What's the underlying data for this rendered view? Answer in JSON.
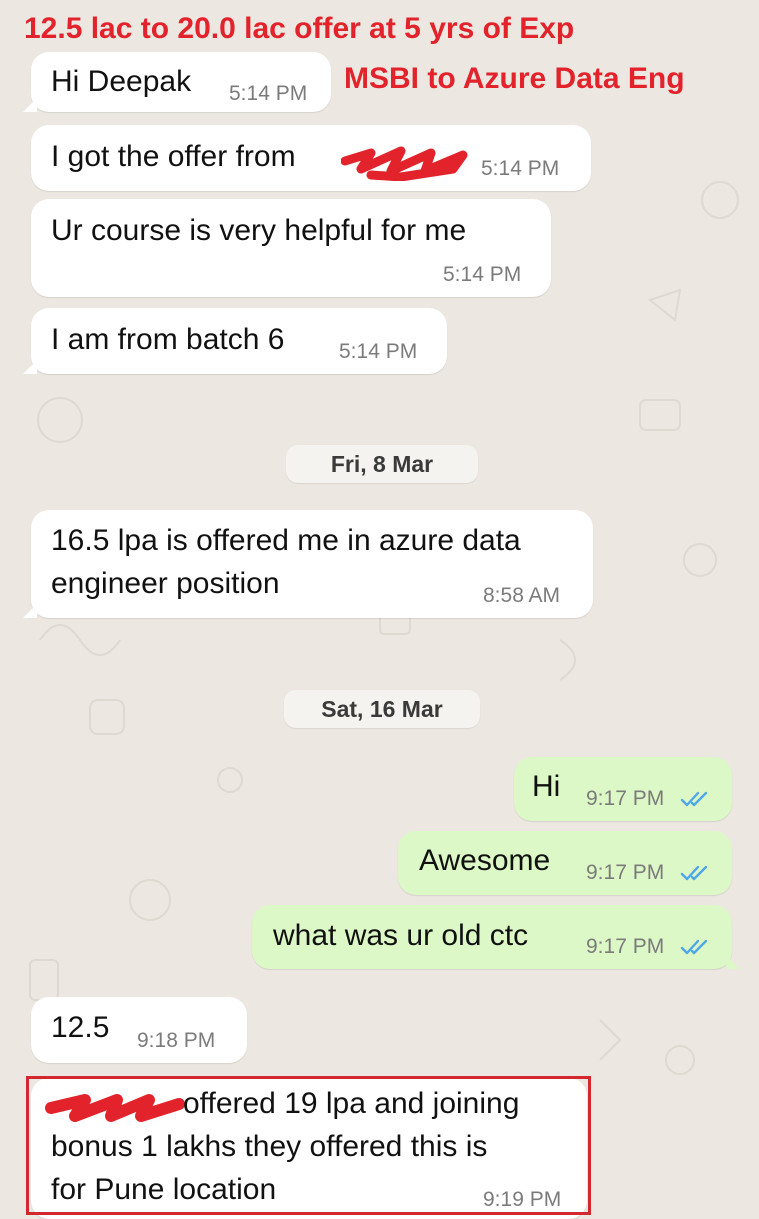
{
  "annotations": {
    "title": "12.5 lac to 20.0 lac offer at 5 yrs of Exp",
    "subtitle": "MSBI to Azure Data Eng"
  },
  "messages": [
    {
      "id": "m1",
      "direction": "in",
      "text": "Hi Deepak",
      "time": "5:14 PM"
    },
    {
      "id": "m2",
      "direction": "in",
      "text": "I got the offer from",
      "time": "5:14 PM"
    },
    {
      "id": "m3",
      "direction": "in",
      "text": "Ur course is very helpful for me",
      "time": "5:14 PM"
    },
    {
      "id": "m4",
      "direction": "in",
      "text": "I am from batch 6",
      "time": "5:14 PM"
    },
    {
      "id": "m5",
      "direction": "in",
      "lines": [
        "16.5 lpa is offered me in azure data",
        "engineer position"
      ],
      "time": "8:58 AM"
    },
    {
      "id": "m6",
      "direction": "out",
      "text": "Hi",
      "time": "9:17 PM",
      "status": "read"
    },
    {
      "id": "m7",
      "direction": "out",
      "text": "Awesome",
      "time": "9:17 PM",
      "status": "read"
    },
    {
      "id": "m8",
      "direction": "out",
      "text": "what was ur old ctc",
      "time": "9:17 PM",
      "status": "read"
    },
    {
      "id": "m9",
      "direction": "in",
      "text": "12.5",
      "time": "9:18 PM"
    },
    {
      "id": "m10",
      "direction": "in",
      "lines": [
        "offered 19 lpa and joining",
        "bonus 1 lakhs they offered this is",
        "for Pune location"
      ],
      "time": "9:19 PM",
      "highlighted": true
    }
  ],
  "date_separators": [
    "Fri, 8 Mar",
    "Sat, 16 Mar"
  ],
  "colors": {
    "incoming_bubble": "#ffffff",
    "outgoing_bubble": "#dcf8c6",
    "chat_background": "#ece8e1",
    "read_ticks": "#4fa6e8",
    "annotation_red": "#e2232b"
  },
  "icons": {
    "read_receipt": "double-check-icon",
    "redaction": "red-scribble"
  }
}
